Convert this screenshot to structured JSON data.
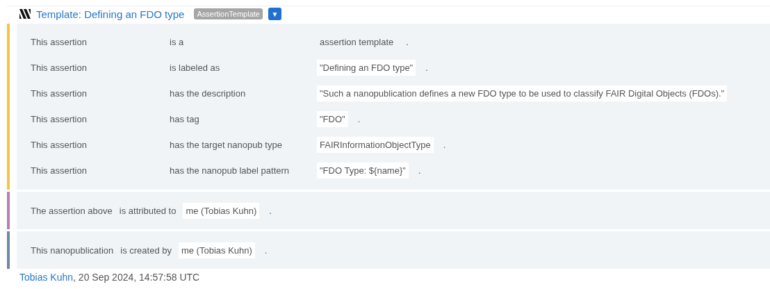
{
  "header": {
    "title": "Template: Defining an FDO type",
    "badge": "AssertionTemplate",
    "menu_button": "▼"
  },
  "sections": [
    {
      "kind": "assertion",
      "color": "#f5c542",
      "rows": [
        {
          "subject": "This assertion",
          "predicate": "is a",
          "object": "assertion template",
          "kind": "plain",
          "end": "."
        },
        {
          "subject": "This assertion",
          "predicate": "is labeled as",
          "object": "\"Defining an FDO type\"",
          "kind": "boxed",
          "end": "."
        },
        {
          "subject": "This assertion",
          "predicate": "has the description",
          "object": "\"Such a nanopublication defines a new FDO type to be used to classify FAIR Digital Objects (FDOs).\"",
          "kind": "boxed"
        },
        {
          "subject": "This assertion",
          "predicate": "has tag",
          "object": "\"FDO\"",
          "kind": "boxed",
          "end": "."
        },
        {
          "subject": "This assertion",
          "predicate": "has the target nanopub type",
          "object": "FAIRInformationObjectType",
          "kind": "boxed",
          "end": "."
        },
        {
          "subject": "This assertion",
          "predicate": "has the nanopub label pattern",
          "object": "\"FDO Type: ${name}\"",
          "kind": "boxed",
          "end": "."
        }
      ]
    },
    {
      "kind": "inline",
      "color": "#b87fb0",
      "rows": [
        {
          "subject": "The assertion above",
          "predicate": "is attributed to",
          "object": "me (Tobias Kuhn)",
          "kind": "boxed",
          "end": "."
        }
      ]
    },
    {
      "kind": "inline",
      "color": "#6f87a3",
      "rows": [
        {
          "subject": "This nanopublication",
          "predicate": "is created by",
          "object": "me (Tobias Kuhn)",
          "kind": "boxed",
          "end": "."
        }
      ]
    }
  ],
  "footer": {
    "author": "Tobias Kuhn",
    "date": ", 20 Sep 2024, 14:57:58 UTC"
  }
}
